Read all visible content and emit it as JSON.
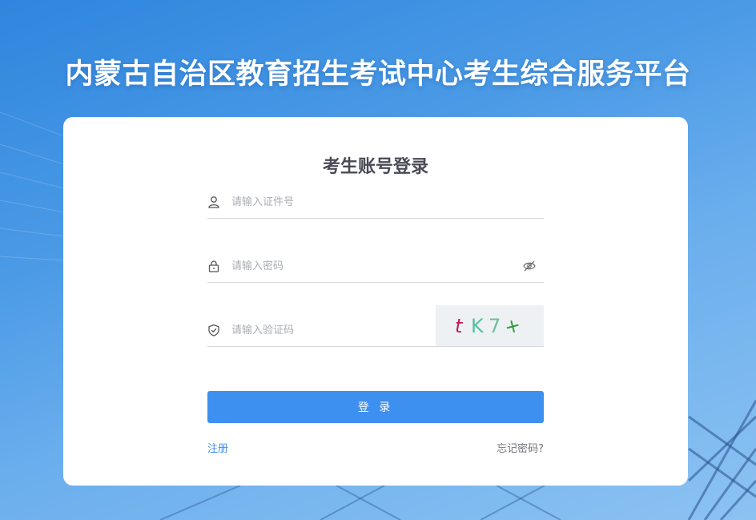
{
  "page": {
    "title": "内蒙古自治区教育招生考试中心考生综合服务平台"
  },
  "login": {
    "heading": "考生账号登录",
    "id_field": {
      "placeholder": "请输入证件号",
      "icon": "user-icon"
    },
    "password_field": {
      "placeholder": "请输入密码",
      "icon": "lock-icon",
      "toggle_icon": "eye-slash-icon"
    },
    "captcha_field": {
      "placeholder": "请输入验证码",
      "icon": "shield-check-icon"
    },
    "captcha": {
      "chars": [
        "t",
        "K",
        "7",
        "+"
      ],
      "colors": [
        "#c2185b",
        "#4fc3a1",
        "#6fbf9a",
        "#2e9e3a"
      ]
    },
    "submit_label": "登 录",
    "register_label": "注册",
    "forgot_label": "忘记密码?"
  },
  "colors": {
    "accent": "#3d8ff0",
    "background": "#4b9ae6"
  }
}
